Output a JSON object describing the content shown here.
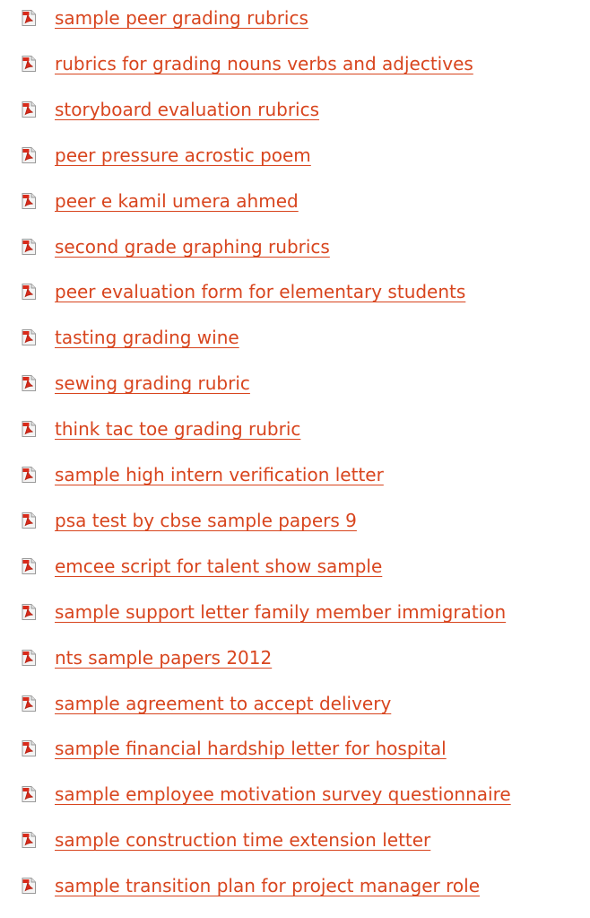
{
  "colors": {
    "link": "#d8451e",
    "icon_red": "#d92b1b",
    "icon_page": "#f4f4f4",
    "icon_border": "#9a9a9a"
  },
  "icon": "pdf-file-icon",
  "links": [
    {
      "label": "sample peer grading rubrics"
    },
    {
      "label": "rubrics for grading nouns verbs and adjectives"
    },
    {
      "label": "storyboard evaluation rubrics"
    },
    {
      "label": "peer pressure acrostic poem"
    },
    {
      "label": "peer e kamil umera ahmed"
    },
    {
      "label": "second grade graphing rubrics"
    },
    {
      "label": "peer evaluation form for elementary students"
    },
    {
      "label": "tasting grading wine"
    },
    {
      "label": "sewing grading rubric"
    },
    {
      "label": "think tac toe grading rubric"
    },
    {
      "label": "sample high intern verification letter"
    },
    {
      "label": "psa test by cbse sample papers 9"
    },
    {
      "label": "emcee script for talent show sample"
    },
    {
      "label": "sample support letter family member immigration"
    },
    {
      "label": "nts sample papers 2012"
    },
    {
      "label": "sample agreement to accept delivery"
    },
    {
      "label": "sample financial hardship letter for hospital"
    },
    {
      "label": "sample employee motivation survey questionnaire"
    },
    {
      "label": "sample construction time extension letter"
    },
    {
      "label": "sample transition plan for project manager role"
    }
  ]
}
